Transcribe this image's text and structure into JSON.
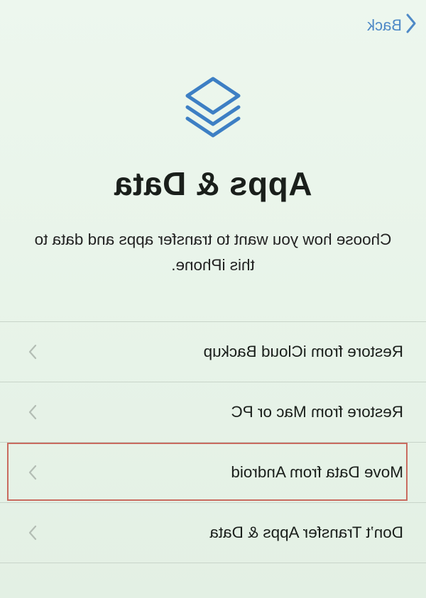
{
  "nav": {
    "back_label": "Back"
  },
  "header": {
    "icon": "stacked-layers-icon",
    "title": "Apps & Data",
    "subtitle": "Choose how you want to transfer apps and data to this iPhone."
  },
  "options": [
    {
      "label": "Restore from iCloud Backup"
    },
    {
      "label": "Restore from Mac or PC"
    },
    {
      "label": "Move Data from Android",
      "highlighted": true
    },
    {
      "label": "Don’t Transfer Apps & Data"
    }
  ],
  "colors": {
    "accent": "#4f8ac7",
    "highlight_border": "#c96b5f",
    "background": "#e9f4ea"
  }
}
